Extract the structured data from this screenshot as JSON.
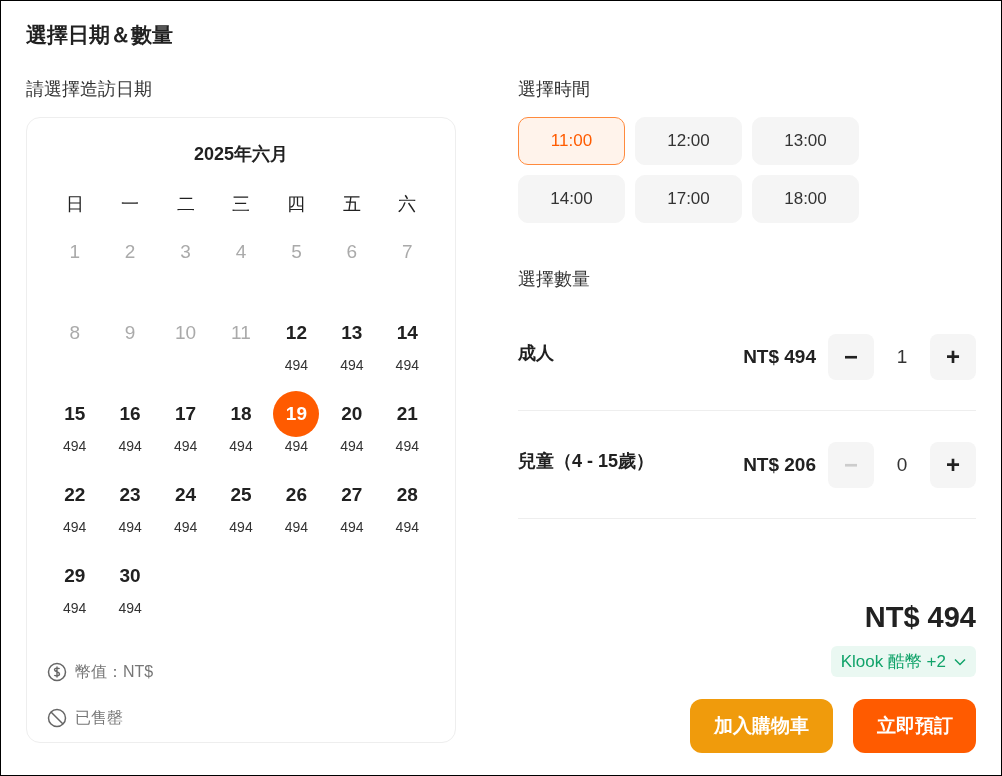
{
  "title": "選擇日期＆數量",
  "date_section": {
    "label": "請選擇造訪日期",
    "month": "2025年六月",
    "weekdays": [
      "日",
      "一",
      "二",
      "三",
      "四",
      "五",
      "六"
    ],
    "days": [
      {
        "day": "1",
        "disabled": true,
        "selected": false
      },
      {
        "day": "2",
        "disabled": true,
        "selected": false
      },
      {
        "day": "3",
        "disabled": true,
        "selected": false
      },
      {
        "day": "4",
        "disabled": true,
        "selected": false
      },
      {
        "day": "5",
        "disabled": true,
        "selected": false
      },
      {
        "day": "6",
        "disabled": true,
        "selected": false
      },
      {
        "day": "7",
        "disabled": true,
        "selected": false
      },
      {
        "day": "8",
        "disabled": true,
        "selected": false
      },
      {
        "day": "9",
        "disabled": true,
        "selected": false
      },
      {
        "day": "10",
        "disabled": true,
        "selected": false
      },
      {
        "day": "11",
        "disabled": true,
        "selected": false
      },
      {
        "day": "12",
        "price": "494",
        "disabled": false,
        "selected": false
      },
      {
        "day": "13",
        "price": "494",
        "disabled": false,
        "selected": false
      },
      {
        "day": "14",
        "price": "494",
        "disabled": false,
        "selected": false
      },
      {
        "day": "15",
        "price": "494",
        "disabled": false,
        "selected": false
      },
      {
        "day": "16",
        "price": "494",
        "disabled": false,
        "selected": false
      },
      {
        "day": "17",
        "price": "494",
        "disabled": false,
        "selected": false
      },
      {
        "day": "18",
        "price": "494",
        "disabled": false,
        "selected": false
      },
      {
        "day": "19",
        "price": "494",
        "disabled": false,
        "selected": true
      },
      {
        "day": "20",
        "price": "494",
        "disabled": false,
        "selected": false
      },
      {
        "day": "21",
        "price": "494",
        "disabled": false,
        "selected": false
      },
      {
        "day": "22",
        "price": "494",
        "disabled": false,
        "selected": false
      },
      {
        "day": "23",
        "price": "494",
        "disabled": false,
        "selected": false
      },
      {
        "day": "24",
        "price": "494",
        "disabled": false,
        "selected": false
      },
      {
        "day": "25",
        "price": "494",
        "disabled": false,
        "selected": false
      },
      {
        "day": "26",
        "price": "494",
        "disabled": false,
        "selected": false
      },
      {
        "day": "27",
        "price": "494",
        "disabled": false,
        "selected": false
      },
      {
        "day": "28",
        "price": "494",
        "disabled": false,
        "selected": false
      },
      {
        "day": "29",
        "price": "494",
        "disabled": false,
        "selected": false
      },
      {
        "day": "30",
        "price": "494",
        "disabled": false,
        "selected": false
      }
    ],
    "legend": [
      {
        "kind": "currency",
        "text": "幣值：NT$"
      },
      {
        "kind": "sold_out",
        "text": "已售罄"
      }
    ]
  },
  "time_section": {
    "label": "選擇時間",
    "slots": [
      {
        "time": "11:00",
        "selected": true
      },
      {
        "time": "12:00",
        "selected": false
      },
      {
        "time": "13:00",
        "selected": false
      },
      {
        "time": "14:00",
        "selected": false
      },
      {
        "time": "17:00",
        "selected": false
      },
      {
        "time": "18:00",
        "selected": false
      }
    ]
  },
  "quantity_section": {
    "label": "選擇數量",
    "rows": [
      {
        "name": "成人",
        "price": "NT$ 494",
        "minus": "−",
        "count": "1",
        "plus": "+",
        "minus_disabled": false
      },
      {
        "name": "兒童（4 - 15歲）",
        "price": "NT$ 206",
        "minus": "−",
        "count": "0",
        "plus": "+",
        "minus_disabled": true
      }
    ]
  },
  "total": "NT$ 494",
  "reward": "Klook 酷幣 +2",
  "buttons": [
    {
      "kind": "cart",
      "label": "加入購物車"
    },
    {
      "kind": "book",
      "label": "立即預訂"
    }
  ]
}
